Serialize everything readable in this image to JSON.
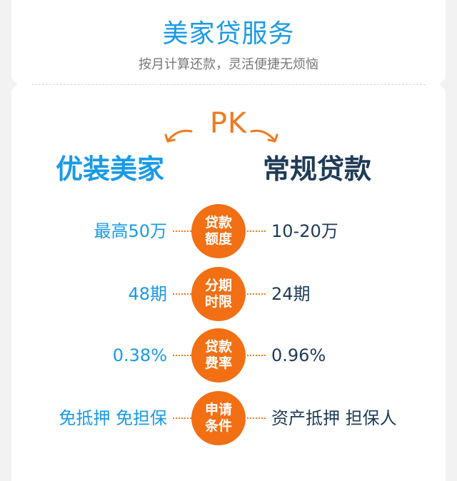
{
  "header": {
    "title": "美家贷服务",
    "subtitle": "按月计算还款，灵活便捷无烦恼"
  },
  "compare": {
    "pk": "PK",
    "left_title": "优装美家",
    "right_title": "常规贷款"
  },
  "rows": [
    {
      "left": "最高50万",
      "label_line1": "贷款",
      "label_line2": "额度",
      "right": "10-20万"
    },
    {
      "left": "48期",
      "label_line1": "分期",
      "label_line2": "时限",
      "right": "24期"
    },
    {
      "left": "0.38%",
      "label_line1": "贷款",
      "label_line2": "费率",
      "right": "0.96%"
    },
    {
      "left": "免抵押 免担保",
      "label_line1": "申请",
      "label_line2": "条件",
      "right": "资产抵押 担保人"
    }
  ],
  "colors": {
    "accent_blue": "#1a9ae6",
    "dark_navy": "#1f3b57",
    "orange": "#f26f14",
    "background": "#f2f2f2"
  }
}
